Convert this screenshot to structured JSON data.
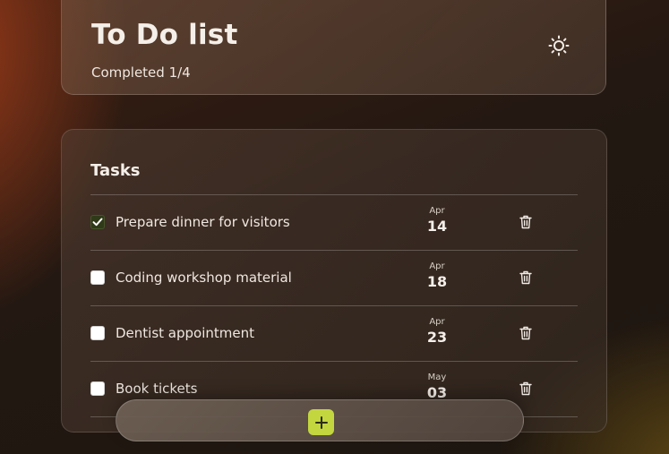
{
  "header": {
    "title": "To Do list",
    "completed_label": "Completed 1/4",
    "theme_toggle_icon": "sun-icon"
  },
  "tasks": {
    "heading": "Tasks",
    "items": [
      {
        "text": "Prepare dinner for visitors",
        "done": true,
        "month": "Apr",
        "day": "14",
        "delete_icon": "trash-icon"
      },
      {
        "text": "Coding workshop material",
        "done": false,
        "month": "Apr",
        "day": "18",
        "delete_icon": "trash-icon"
      },
      {
        "text": "Dentist appointment",
        "done": false,
        "month": "Apr",
        "day": "23",
        "delete_icon": "trash-icon"
      },
      {
        "text": "Book tickets",
        "done": false,
        "month": "May",
        "day": "03",
        "delete_icon": "trash-icon"
      }
    ]
  },
  "add_bar": {
    "add_icon": "plus-icon",
    "accent_color": "#c3d63f"
  }
}
